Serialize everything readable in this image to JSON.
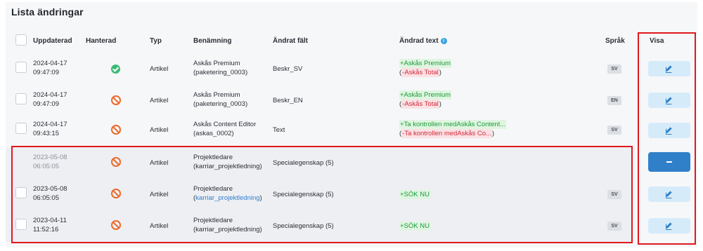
{
  "title": "Lista ändringar",
  "columns": {
    "updated": "Uppdaterad",
    "handled": "Hanterad",
    "type": "Typ",
    "name": "Benämning",
    "changed_field": "Ändrat fält",
    "changed_text": "Ändrad text",
    "language": "Språk",
    "view": "Visa"
  },
  "info_icon": "i",
  "rows": [
    {
      "date": "2024-04-17",
      "time": "09:47:09",
      "handled": "ok",
      "type": "Artikel",
      "name": "Askås Premium",
      "code": "(paketering_0003)",
      "field": "Beskr_SV",
      "added": "+Askås Premium",
      "removed": "-Askås Total",
      "lang": "SV",
      "view_state": "edit"
    },
    {
      "date": "2024-04-17",
      "time": "09:47:09",
      "handled": "deny",
      "type": "Artikel",
      "name": "Askås Premium",
      "code": "(paketering_0003)",
      "field": "Beskr_EN",
      "added": "+Askås Premium",
      "removed": "-Askås Total",
      "lang": "EN",
      "view_state": "edit"
    },
    {
      "date": "2024-04-17",
      "time": "09:43:15",
      "handled": "deny",
      "type": "Artikel",
      "name": "Askås Content Editor",
      "code": "(askas_0002)",
      "field": "Text",
      "added": "+Ta kontrollen medAskås Content...",
      "removed": "-Ta kontrollen medAskås Co...",
      "lang": "SV",
      "view_state": "edit"
    },
    {
      "date": "2023-05-08",
      "time": "06:05:05",
      "handled": "deny",
      "type": "Artikel",
      "name": "Projektledare",
      "code": "(karriar_projektledning)",
      "field": "Specialegenskap (5)",
      "added": "",
      "removed": "",
      "lang": "",
      "view_state": "collapse"
    },
    {
      "date": "2023-05-08",
      "time": "06:05:05",
      "handled": "deny",
      "type": "Artikel",
      "name": "Projektledare",
      "code": "karriar_projektledning",
      "field": "Specialegenskap (5)",
      "added": "+SÖK NU",
      "removed": "",
      "lang": "SV",
      "view_state": "edit"
    },
    {
      "date": "2023-04-11",
      "time": "11:52:16",
      "handled": "deny",
      "type": "Artikel",
      "name": "Projektledare",
      "code": "(karriar_projektledning)",
      "field": "Specialegenskap (5)",
      "added": "+SÖK NU",
      "removed": "",
      "lang": "SV",
      "view_state": "edit"
    }
  ]
}
